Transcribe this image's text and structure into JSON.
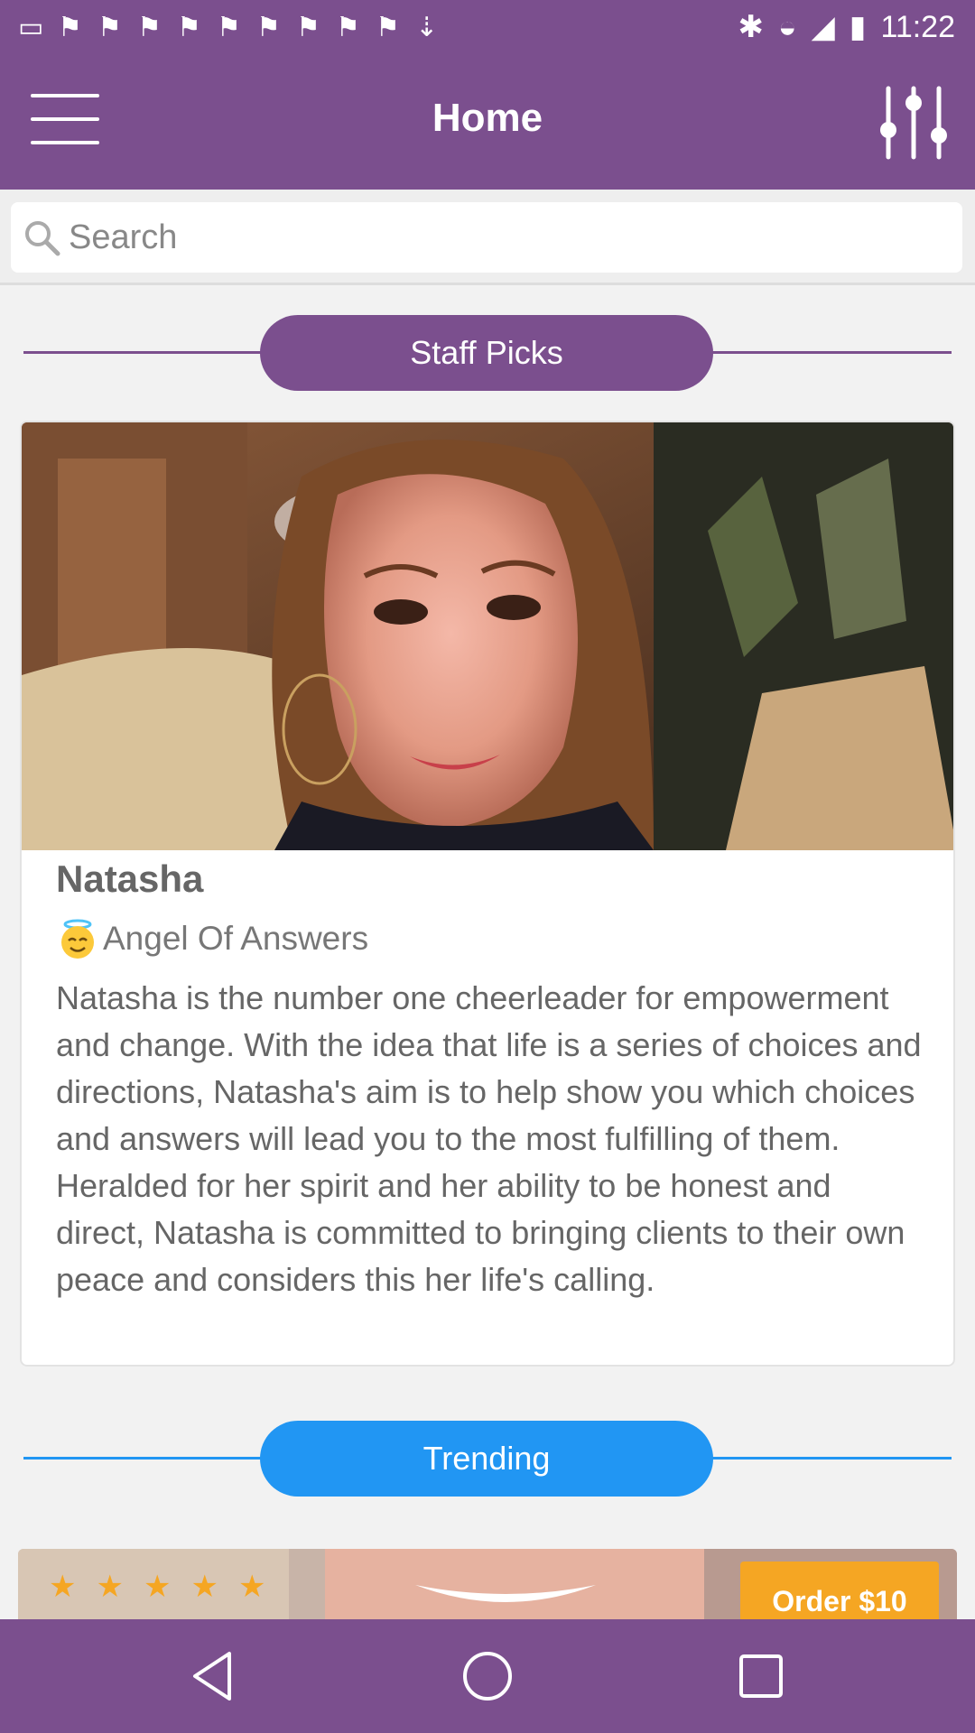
{
  "status_bar": {
    "time": "11:22",
    "notification_count": 11
  },
  "header": {
    "title": "Home"
  },
  "search": {
    "placeholder": "Search"
  },
  "staff_picks": {
    "label": "Staff Picks",
    "color": "#7b4f8e"
  },
  "card": {
    "name": "Natasha",
    "subtitle": "Angel Of Answers",
    "description": "Natasha is the number one cheerleader for empowerment and change. With the idea that life is a series of choices and directions, Natasha's aim is to help show you which choices and answers will lead you to the most fulfilling of them. Heralded for her spirit and her ability to be honest and direct, Natasha is committed to bringing clients to their own peace and considers this her life's calling."
  },
  "trending": {
    "label": "Trending",
    "color": "#2196f3"
  },
  "promo": {
    "rating": 5,
    "order_label": "Order $10"
  },
  "nav": {
    "back": "back-icon",
    "home": "home-icon",
    "recents": "recents-icon"
  },
  "colors": {
    "primary": "#7b4f8e",
    "accent": "#2196f3",
    "order": "#f5a623"
  }
}
